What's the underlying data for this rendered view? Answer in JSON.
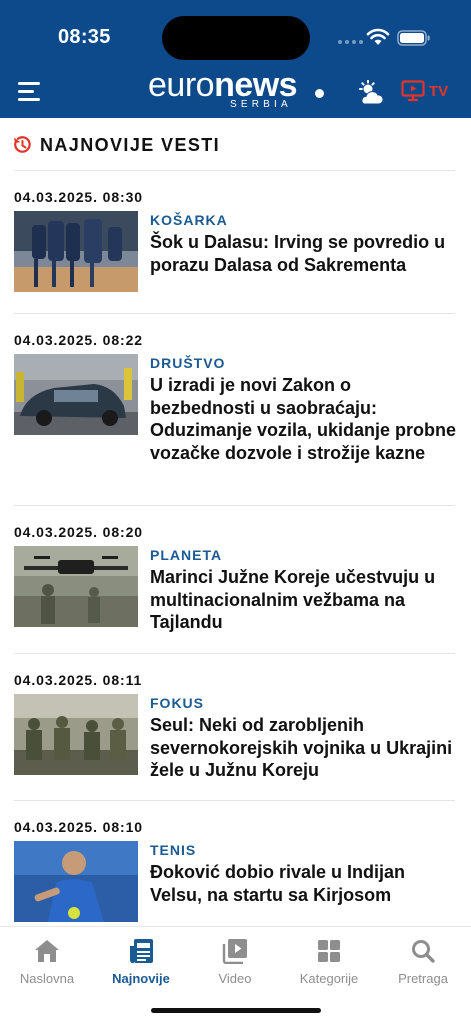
{
  "status_bar": {
    "time": "08:35"
  },
  "header": {
    "logo_thin": "euro",
    "logo_bold": "news",
    "logo_sub": "SERBIA",
    "tv_label": "TV",
    "colors": {
      "background": "#0d4a8c",
      "tv_accent": "#e3342a"
    }
  },
  "section": {
    "title": "NAJNOVIJE VESTI",
    "icon": "clock-refresh-icon",
    "icon_color": "#e3342a"
  },
  "articles": [
    {
      "date": "04.03.2025. 08:30",
      "category": "KOŠARKA",
      "title": "Šok u Dalasu: Irving se povredio u porazu Dalasa od Sakrementa"
    },
    {
      "date": "04.03.2025. 08:22",
      "category": "DRUŠTVO",
      "title": "U izradi je novi Zakon o bezbednosti u saobraćaju: Oduzimanje vozila, ukidanje probne vozačke dozvole i strožije kazne"
    },
    {
      "date": "04.03.2025. 08:20",
      "category": "PLANETA",
      "title": "Marinci Južne Koreje učestvuju u multinacionalnim vežbama na Tajlandu"
    },
    {
      "date": "04.03.2025. 08:11",
      "category": "FOKUS",
      "title": "Seul: Neki od zarobljenih severnokorejskih vojnika u Ukrajini žele u Južnu Koreju"
    },
    {
      "date": "04.03.2025. 08:10",
      "category": "TENIS",
      "title": "Đoković dobio rivale u Indijan Velsu, na startu sa Kirjosom"
    }
  ],
  "bottom_nav": {
    "items": [
      {
        "label": "Naslovna",
        "icon": "home-icon",
        "active": false
      },
      {
        "label": "Najnovije",
        "icon": "newspaper-icon",
        "active": true
      },
      {
        "label": "Video",
        "icon": "video-library-icon",
        "active": false
      },
      {
        "label": "Kategorije",
        "icon": "grid-icon",
        "active": false
      },
      {
        "label": "Pretraga",
        "icon": "search-icon",
        "active": false
      }
    ],
    "colors": {
      "active": "#1b5a92",
      "inactive": "#8e8e8e"
    }
  }
}
